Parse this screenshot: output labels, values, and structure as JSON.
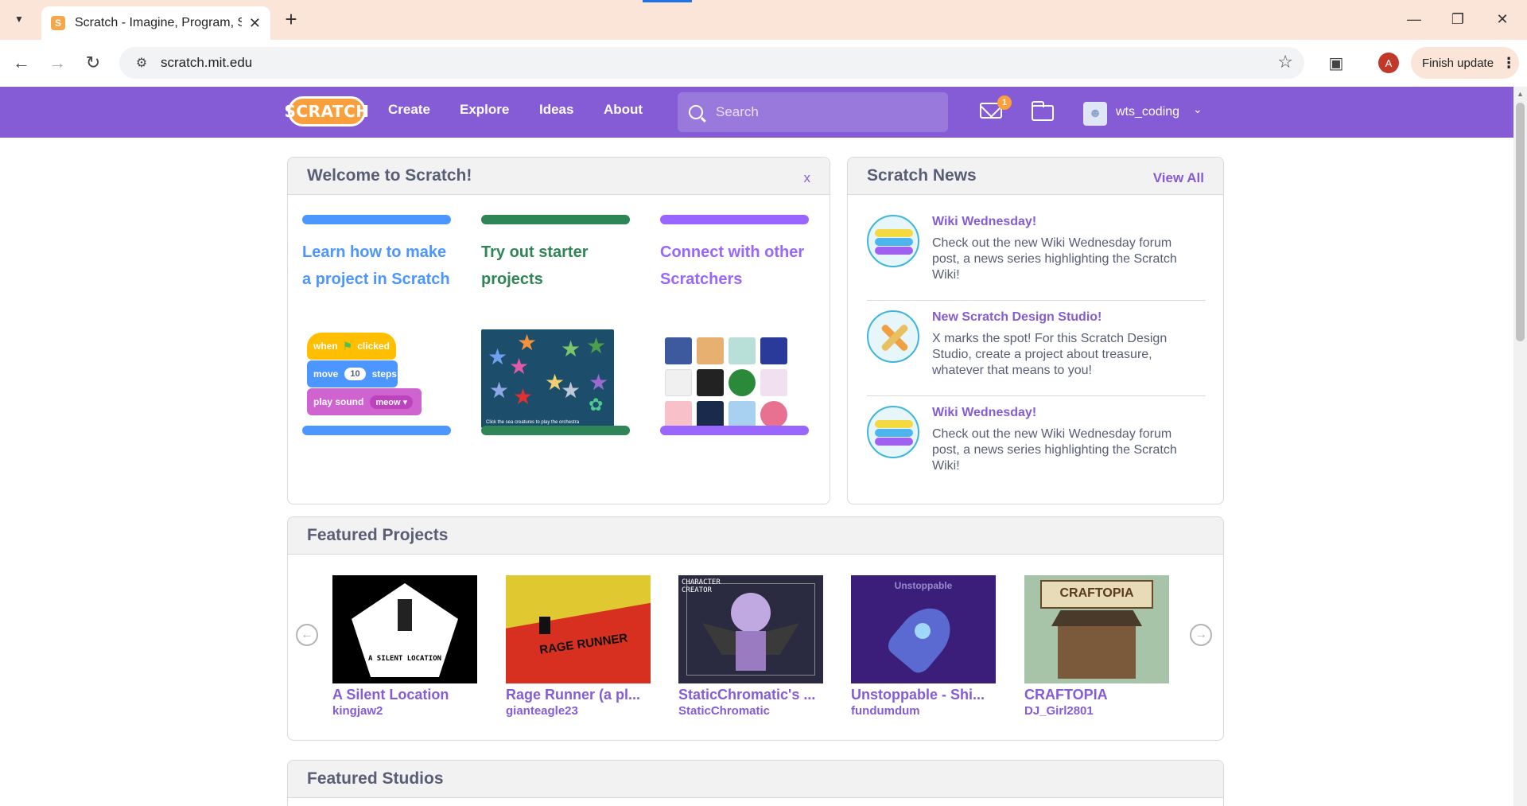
{
  "browser": {
    "tab_title": "Scratch - Imagine, Program, Share",
    "tab_favicon": "S",
    "url": "scratch.mit.edu",
    "profile_initial": "A",
    "finish_update_label": "Finish update"
  },
  "nav": {
    "logo_text": "SCRATCH",
    "links": [
      "Create",
      "Explore",
      "Ideas",
      "About"
    ],
    "search_placeholder": "Search",
    "messages_count": "1",
    "username": "wts_coding"
  },
  "welcome": {
    "title": "Welcome to Scratch!",
    "close_label": "x",
    "columns": [
      {
        "text": "Learn how to make a project in Scratch",
        "color": "#4c97ff"
      },
      {
        "text": "Try out starter projects",
        "color": "#0f7e3f"
      },
      {
        "text": "Connect with other Scratchers",
        "color": "#9966ff"
      }
    ],
    "blocks": {
      "when": "when",
      "clicked": "clicked",
      "move": "move",
      "steps_value": "10",
      "steps": "steps",
      "play_sound": "play sound",
      "sound": "meow"
    },
    "starter_caption": "Click the sea creatures to play the orchestra"
  },
  "news": {
    "title": "Scratch News",
    "view_all": "View All",
    "items": [
      {
        "title": "Wiki Wednesday!",
        "body": "Check out the new Wiki Wednesday forum post, a news series highlighting the Scratch Wiki!"
      },
      {
        "title": "New Scratch Design Studio!",
        "body": "X marks the spot! For this Scratch Design Studio, create a project about treasure, whatever that means to you!"
      },
      {
        "title": "Wiki Wednesday!",
        "body": "Check out the new Wiki Wednesday forum post, a news series highlighting the Scratch Wiki!"
      }
    ]
  },
  "featured_projects": {
    "title": "Featured Projects",
    "items": [
      {
        "title": "A Silent Location",
        "author": "kingjaw2",
        "thumb_text": "A SILENT LOCATION"
      },
      {
        "title": "Rage Runner (a pl...",
        "author": "gianteagle23",
        "thumb_text": "RAGE RUNNER"
      },
      {
        "title": "StaticChromatic's ...",
        "author": "StaticChromatic",
        "thumb_text": "CHARACTER CREATOR"
      },
      {
        "title": "Unstoppable - Shi...",
        "author": "fundumdum",
        "thumb_text": "Unstoppable"
      },
      {
        "title": "CRAFTOPIA",
        "author": "DJ_Girl2801",
        "thumb_text": "CRAFTOPIA"
      }
    ]
  },
  "featured_studios": {
    "title": "Featured Studios"
  },
  "colors": {
    "scratch_purple": "#855cd6",
    "scratch_orange": "#f9a03c",
    "chrome_tab_bg": "#fbe4d8"
  }
}
